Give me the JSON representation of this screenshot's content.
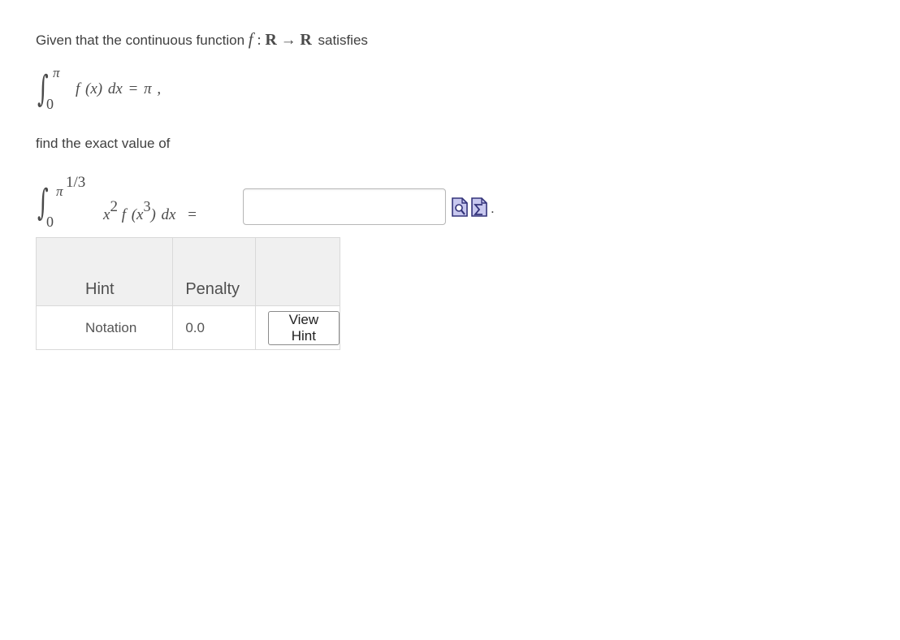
{
  "problem": {
    "intro_text": "Given that the continuous function",
    "func_f": "f",
    "func_colon": ":",
    "domain_R": "R",
    "arrow": "→",
    "codomain_R": "R",
    "intro_suffix": "satisfies",
    "given_integral": {
      "upper_limit": "π",
      "lower_limit": "0",
      "integrand": "f (x) dx = π ,"
    },
    "find_text": "find the exact value of",
    "target_integral": {
      "upper_limit_base": "π",
      "upper_limit_exp": "1/3",
      "lower_limit": "0",
      "integrand_x": "x",
      "integrand_x_exp": "2",
      "integrand_f": "f (x",
      "integrand_inner_exp": "3",
      "integrand_tail": ") dx",
      "equals": "="
    },
    "answer_value": "",
    "trailing_period": "."
  },
  "toolbar": {
    "preview_icon": "preview-icon",
    "equation_icon": "equation-editor-icon"
  },
  "hints_table": {
    "headers": [
      "Hint",
      "Penalty",
      ""
    ],
    "rows": [
      {
        "hint": "Notation",
        "penalty": "0.0",
        "button_label": "View Hint"
      }
    ]
  },
  "colors": {
    "icon_fill": "#c8c8ef",
    "icon_border": "#33337a",
    "table_header_bg": "#f0f0f0",
    "table_border": "#d9d9d9"
  }
}
